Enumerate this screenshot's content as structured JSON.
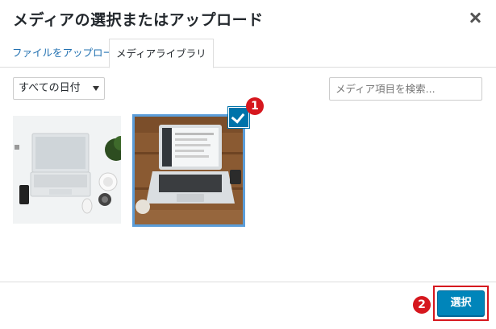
{
  "modal": {
    "title": "メディアの選択またはアップロード"
  },
  "tabs": [
    {
      "label": "ファイルをアップロード",
      "active": false
    },
    {
      "label": "メディアライブラリ",
      "active": true
    }
  ],
  "filters": {
    "date_selected": "すべての日付",
    "search_placeholder": "メディア項目を検索..."
  },
  "media_items": [
    {
      "description": "laptop on desk top view",
      "selected": false
    },
    {
      "description": "laptop on wooden table",
      "selected": true
    }
  ],
  "annotations": {
    "badge_1": "1",
    "badge_2": "2"
  },
  "footer": {
    "select_label": "選択"
  },
  "colors": {
    "primary_button": "#0085ba",
    "selection_border": "#5b9dd9",
    "checkmark_bg": "#0073aa",
    "annotation_red": "#d6171e",
    "link": "#2271b1"
  }
}
